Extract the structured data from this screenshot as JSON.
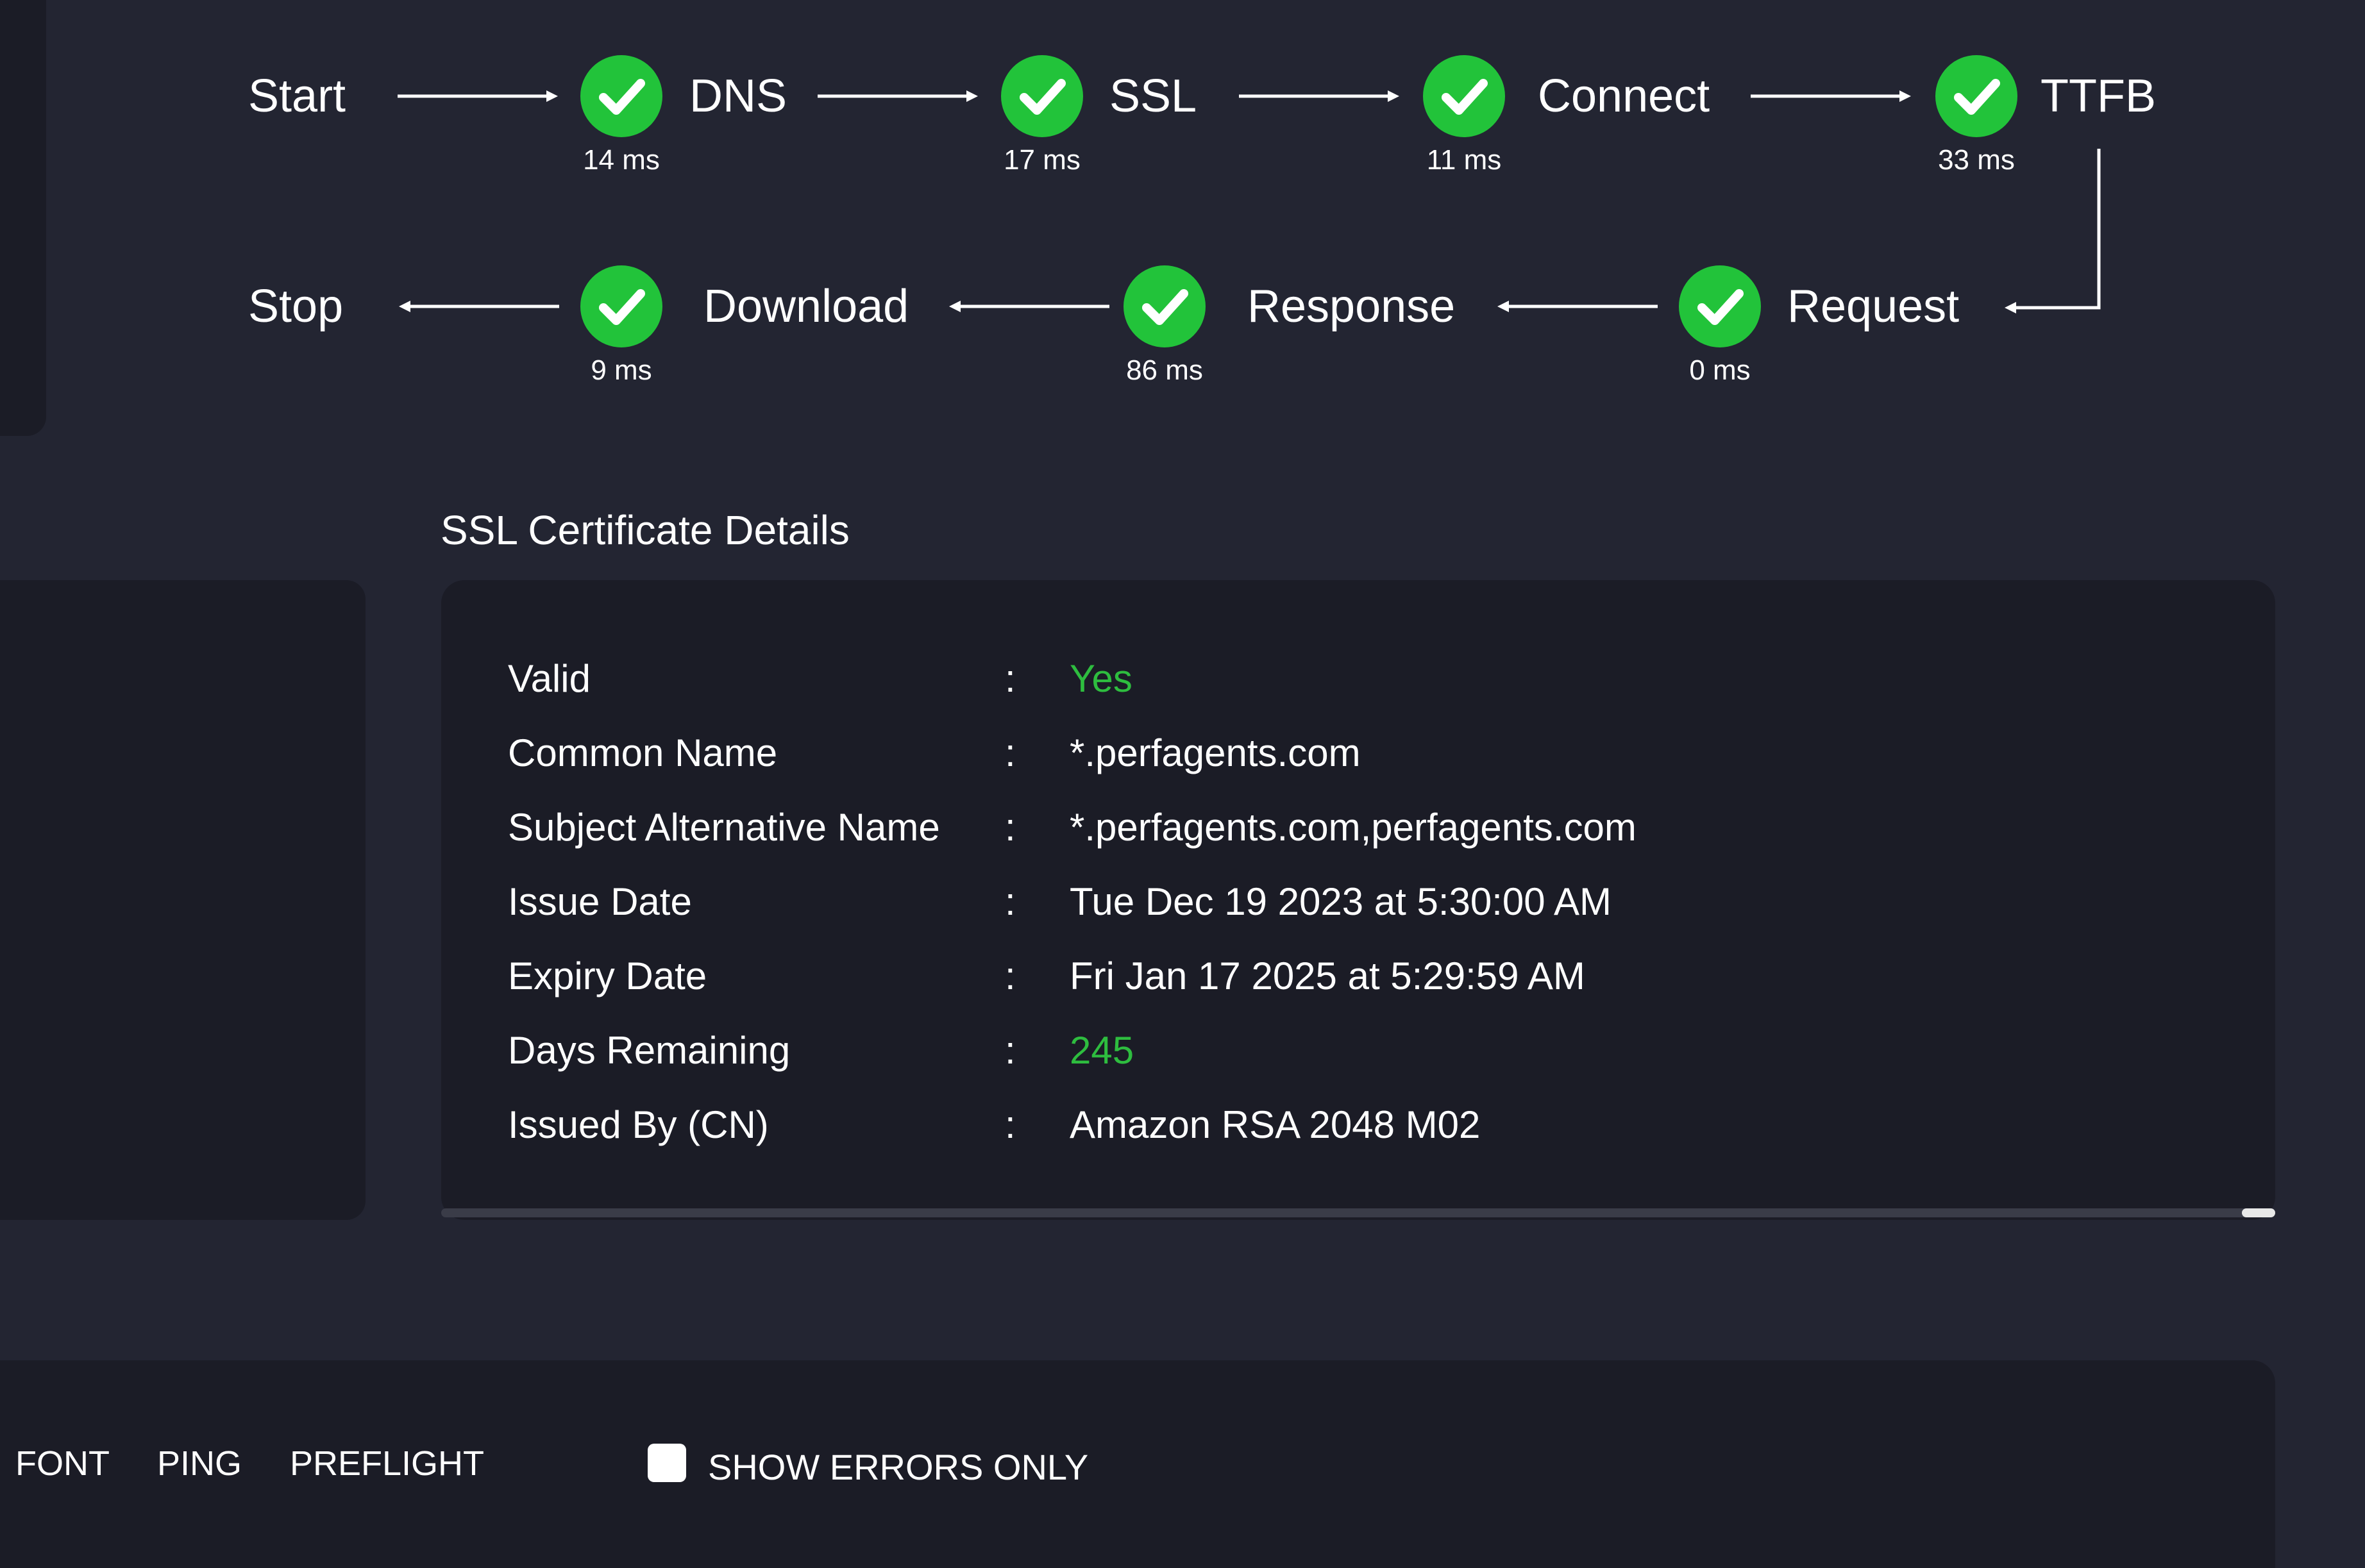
{
  "colors": {
    "background": "#232532",
    "panel": "#1b1c26",
    "success": "#22c33a",
    "positive_text": "#2ebd3f"
  },
  "pipeline": {
    "start_label": "Start",
    "stop_label": "Stop",
    "steps": [
      {
        "label": "DNS",
        "time": "14 ms",
        "status": "success"
      },
      {
        "label": "SSL",
        "time": "17 ms",
        "status": "success"
      },
      {
        "label": "Connect",
        "time": "11 ms",
        "status": "success"
      },
      {
        "label": "TTFB",
        "time": "33 ms",
        "status": "success"
      },
      {
        "label": "Request",
        "time": "0 ms",
        "status": "success"
      },
      {
        "label": "Response",
        "time": "86 ms",
        "status": "success"
      },
      {
        "label": "Download",
        "time": "9 ms",
        "status": "success"
      }
    ],
    "icon": "check-circle-icon"
  },
  "ssl": {
    "title": "SSL Certificate Details",
    "separator": ":",
    "rows": [
      {
        "key": "Valid",
        "value": "Yes",
        "highlight": true
      },
      {
        "key": "Common Name",
        "value": "*.perfagents.com",
        "highlight": false
      },
      {
        "key": "Subject Alternative Name",
        "value": "*.perfagents.com,perfagents.com",
        "highlight": false
      },
      {
        "key": "Issue Date",
        "value": "Tue Dec 19 2023 at 5:30:00 AM",
        "highlight": false
      },
      {
        "key": "Expiry Date",
        "value": "Fri Jan 17 2025 at 5:29:59 AM",
        "highlight": false
      },
      {
        "key": "Days Remaining",
        "value": "245",
        "highlight": true
      },
      {
        "key": "Issued By (CN)",
        "value": "Amazon RSA 2048 M02",
        "highlight": false
      }
    ]
  },
  "toolbar": {
    "tabs": [
      "FONT",
      "PING",
      "PREFLIGHT"
    ],
    "show_errors_label": "SHOW ERRORS ONLY",
    "show_errors_checked": false
  }
}
